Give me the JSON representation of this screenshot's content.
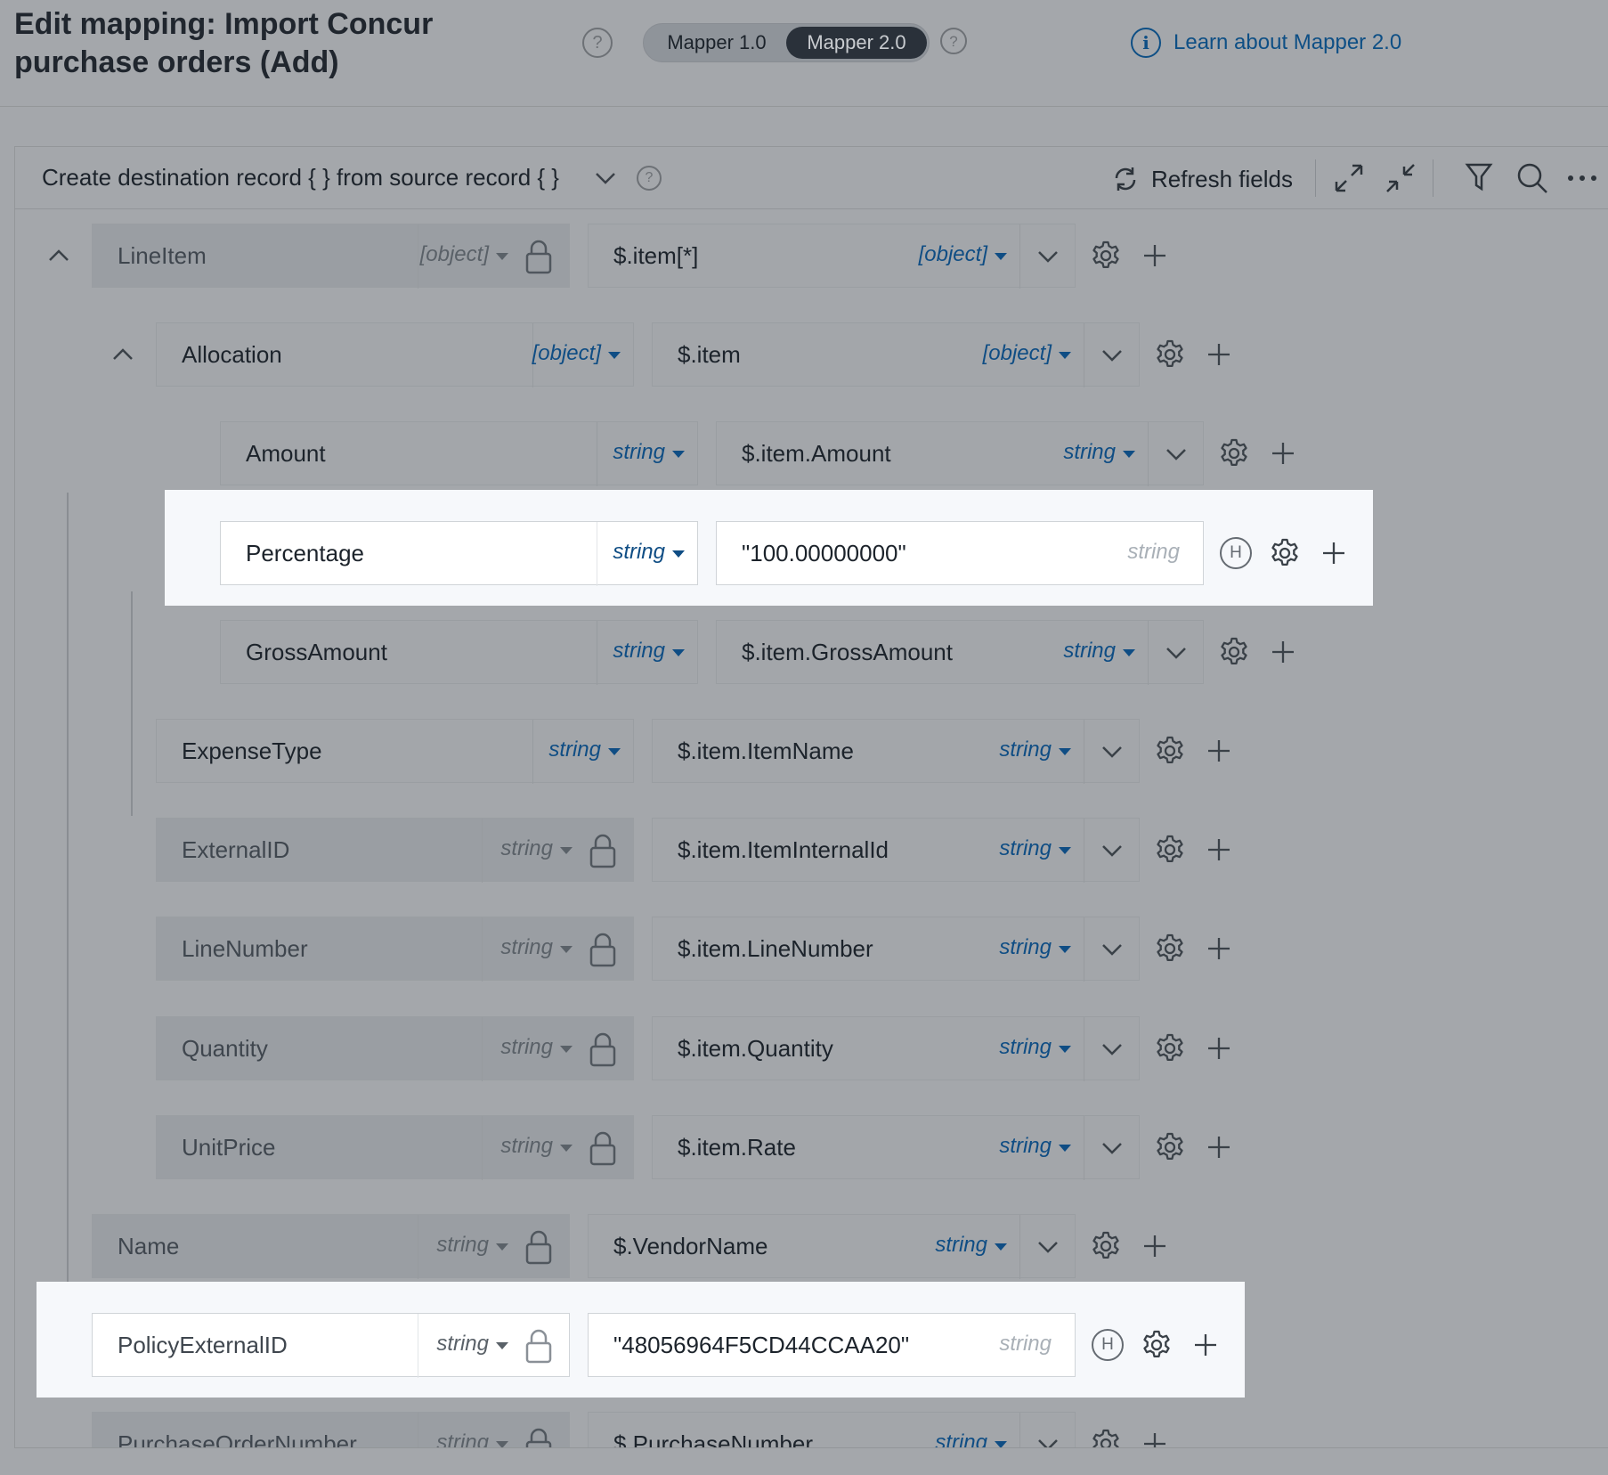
{
  "header": {
    "title": "Edit mapping: Import Concur purchase orders (Add)",
    "help_symbol": "?",
    "toggle": {
      "option1": "Mapper 1.0",
      "option2": "Mapper 2.0",
      "selected": "Mapper 2.0"
    },
    "learn_link": "Learn about Mapper 2.0",
    "info_symbol": "i"
  },
  "toolbar": {
    "title": "Create destination record { } from source record { }",
    "refresh_label": "Refresh fields",
    "icons": [
      "expand-icon",
      "collapse-icon",
      "filter-icon",
      "search-icon",
      "more-icon"
    ]
  },
  "colors": {
    "accent": "#0f4d84",
    "highlight": "#f6f8fb",
    "overlay": "#a4a7ab"
  },
  "rows": [
    {
      "dest": "LineItem",
      "dest_type": "[object]",
      "locked": true,
      "source": "$.item[*]",
      "source_type": "[object]",
      "hardcoded": false,
      "collapsible": true
    },
    {
      "dest": "Allocation",
      "dest_type": "[object]",
      "locked": false,
      "source": "$.item",
      "source_type": "[object]",
      "hardcoded": false,
      "collapsible": true
    },
    {
      "dest": "Amount",
      "dest_type": "string",
      "locked": false,
      "source": "$.item.Amount",
      "source_type": "string",
      "hardcoded": false
    },
    {
      "dest": "Percentage",
      "dest_type": "string",
      "locked": false,
      "source": "\"100.00000000\"",
      "source_type": "string",
      "hardcoded": true,
      "highlighted": true,
      "badge": "H"
    },
    {
      "dest": "GrossAmount",
      "dest_type": "string",
      "locked": false,
      "source": "$.item.GrossAmount",
      "source_type": "string",
      "hardcoded": false
    },
    {
      "dest": "ExpenseType",
      "dest_type": "string",
      "locked": false,
      "source": "$.item.ItemName",
      "source_type": "string",
      "hardcoded": false
    },
    {
      "dest": "ExternalID",
      "dest_type": "string",
      "locked": true,
      "source": "$.item.ItemInternalId",
      "source_type": "string",
      "hardcoded": false
    },
    {
      "dest": "LineNumber",
      "dest_type": "string",
      "locked": true,
      "source": "$.item.LineNumber",
      "source_type": "string",
      "hardcoded": false
    },
    {
      "dest": "Quantity",
      "dest_type": "string",
      "locked": true,
      "source": "$.item.Quantity",
      "source_type": "string",
      "hardcoded": false
    },
    {
      "dest": "UnitPrice",
      "dest_type": "string",
      "locked": true,
      "source": "$.item.Rate",
      "source_type": "string",
      "hardcoded": false
    },
    {
      "dest": "Name",
      "dest_type": "string",
      "locked": true,
      "source": "$.VendorName",
      "source_type": "string",
      "hardcoded": false
    },
    {
      "dest": "PolicyExternalID",
      "dest_type": "string",
      "locked": true,
      "source": "\"48056964F5CD44CCAA20\"",
      "source_type": "string",
      "hardcoded": true,
      "highlighted": true,
      "badge": "H"
    },
    {
      "dest": "PurchaseOrderNumber",
      "dest_type": "string",
      "locked": true,
      "source": "$.PurchaseNumber",
      "source_type": "string",
      "hardcoded": false
    }
  ]
}
